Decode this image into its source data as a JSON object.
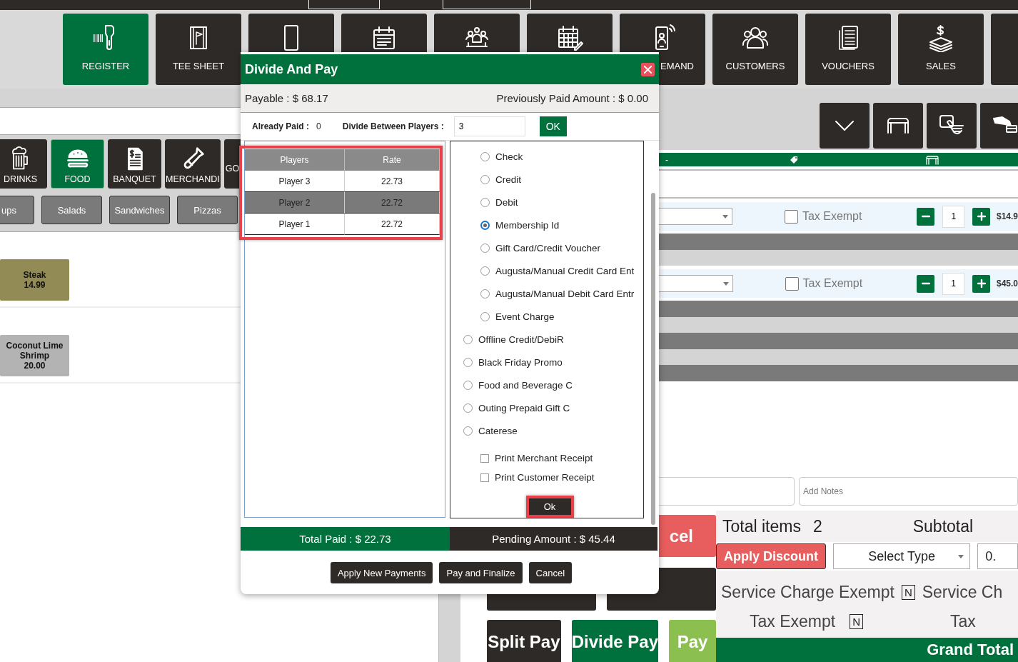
{
  "nav": [
    {
      "label": "REGISTER",
      "kind": "scanner",
      "selected": true
    },
    {
      "label": "TEE SHEET",
      "kind": "sheet",
      "selected": false
    },
    {
      "kind": "tablet",
      "selected": false
    },
    {
      "kind": "calendar-list",
      "selected": false
    },
    {
      "kind": "meeting",
      "selected": false
    },
    {
      "kind": "calendar-grid",
      "selected": false
    },
    {
      "label": "EMAND",
      "kind": "phone",
      "selected": false
    },
    {
      "label": "CUSTOMERS",
      "kind": "people",
      "selected": false
    },
    {
      "label": "VOUCHERS",
      "kind": "document",
      "selected": false
    },
    {
      "label": "SALES",
      "kind": "money",
      "selected": false
    },
    {
      "kind": "blank",
      "selected": false
    }
  ],
  "categories": [
    {
      "label": "DRINKS",
      "kind": "beer",
      "selected": false
    },
    {
      "label": "FOOD",
      "kind": "burger",
      "selected": true
    },
    {
      "label": "BANQUET",
      "kind": "invoice",
      "selected": false
    },
    {
      "label": "MERCHANDI",
      "kind": "bottle",
      "selected": false
    },
    {
      "label": "GO",
      "kind": "golf",
      "selected": false
    }
  ],
  "subcategories": [
    "ups",
    "Salads",
    "Sandwiches",
    "Pizzas"
  ],
  "menu_items": [
    {
      "name": "Steak",
      "price": "14.99",
      "color": "#938b55"
    },
    {
      "name": "Coconut Lime Shrimp",
      "price": "20.00",
      "color": "#b3b3b3"
    }
  ],
  "order_header": {
    "column_1": "-"
  },
  "order_lines": [
    {
      "tax_exempt_label": "Tax Exempt",
      "tax_exempt": false,
      "quantity": "1",
      "price": "$14.9"
    },
    {
      "tax_exempt_label": "Tax Exempt",
      "tax_exempt": false,
      "quantity": "1",
      "price": "$45.0"
    }
  ],
  "notes": {
    "placeholder": "Add Notes"
  },
  "cancel_button": "cel",
  "pay_buttons": [
    {
      "label": "Split Pay",
      "kind": "dark"
    },
    {
      "label": "Divide Pay",
      "kind": "green"
    },
    {
      "label": "Pay",
      "kind": "lime"
    }
  ],
  "summary": {
    "total_items_label": "Total items",
    "total_items": "2",
    "subtotal_label": "Subtotal",
    "apply_discount": "Apply Discount",
    "discount_type": "Select Type",
    "discount_value": "0.",
    "service_charge_exempt_label": "Service Charge Exempt",
    "service_charge_exempt": "N",
    "service_charge_label": "Service Ch",
    "tax_exempt_label": "Tax Exempt",
    "tax_exempt": "N",
    "tax_label": "Tax",
    "grand_total_label": "Grand Total"
  },
  "modal": {
    "title": "Divide And Pay",
    "payable": "Payable : $ 68.17",
    "previously_paid": "Previously Paid Amount : $ 0.00",
    "already_paid_label": "Already Paid :",
    "already_paid": "0",
    "divide_label": "Divide Between Players :",
    "divide_value": "3",
    "ok": "OK",
    "players_table": {
      "columns": [
        "Players",
        "Rate"
      ],
      "rows": [
        {
          "cells": [
            "Player 3",
            "22.73"
          ],
          "selected": false
        },
        {
          "cells": [
            "Player 2",
            "22.72"
          ],
          "selected": true
        },
        {
          "cells": [
            "Player 1",
            "22.72"
          ],
          "selected": false
        }
      ]
    },
    "payment_methods": [
      {
        "label": "Check",
        "kind": "standard",
        "selected": false
      },
      {
        "label": "Credit",
        "kind": "standard",
        "selected": false
      },
      {
        "label": "Debit",
        "kind": "standard",
        "selected": false
      },
      {
        "label": "Membership Id",
        "kind": "standard",
        "selected": true
      },
      {
        "label": "Gift Card/Credit Voucher",
        "kind": "standard",
        "selected": false
      },
      {
        "label": "Augusta/Manual Credit Card Ent",
        "kind": "standard",
        "selected": false
      },
      {
        "label": "Augusta/Manual Debit Card Entr",
        "kind": "standard",
        "selected": false
      },
      {
        "label": "Event Charge",
        "kind": "standard",
        "selected": false
      },
      {
        "label": "Offline Credit/DebiR",
        "kind": "custom",
        "selected": false
      },
      {
        "label": "Black Friday Promo",
        "kind": "custom",
        "selected": false
      },
      {
        "label": "Food and Beverage C",
        "kind": "custom",
        "selected": false
      },
      {
        "label": "Outing Prepaid Gift C",
        "kind": "custom",
        "selected": false
      },
      {
        "label": "Caterese",
        "kind": "custom",
        "selected": false
      }
    ],
    "receipt_options": [
      {
        "label": "Print Merchant Receipt",
        "checked": false
      },
      {
        "label": "Print Customer Receipt",
        "checked": false
      }
    ],
    "confirm": "Ok",
    "total_paid": "Total Paid : $ 22.73",
    "pending": "Pending Amount : $ 45.44",
    "buttons": [
      "Apply New Payments",
      "Pay and Finalize",
      "Cancel"
    ]
  }
}
